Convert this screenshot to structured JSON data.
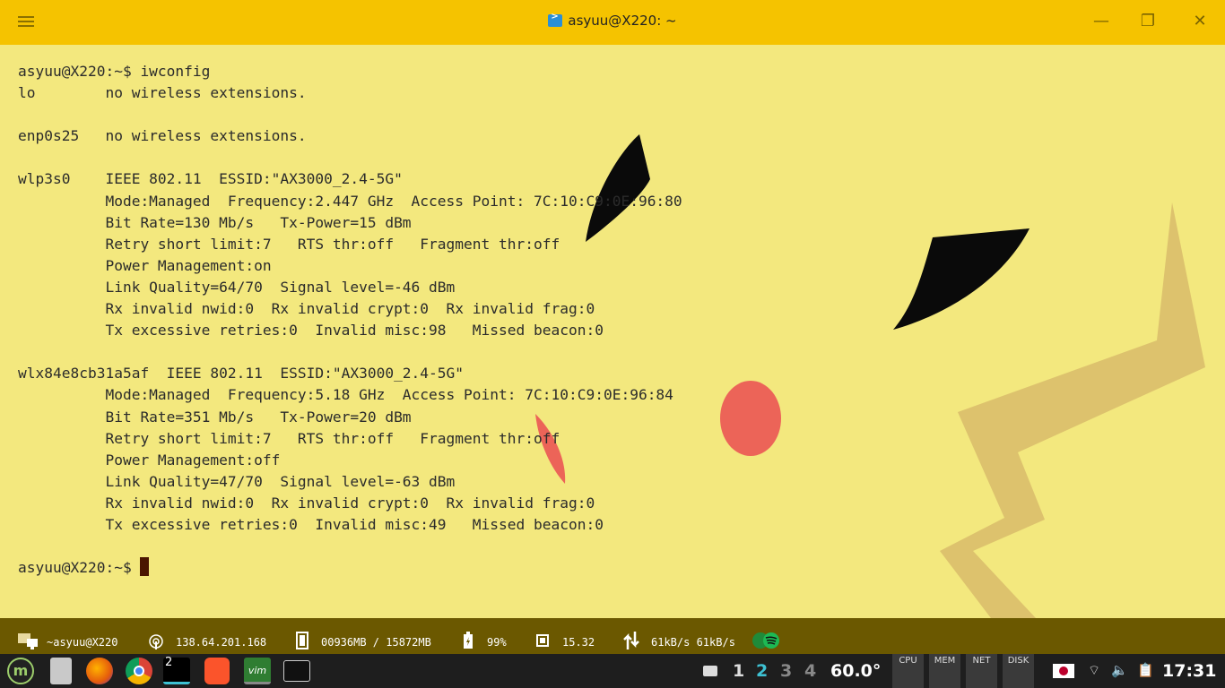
{
  "window": {
    "title": "asyuu@X220: ~",
    "menu_icon": "hamburger-icon",
    "minimize_icon": "minimize-icon",
    "maximize_icon": "restore-icon",
    "close_icon": "close-icon",
    "colors": {
      "titlebar": "#f5c300",
      "background": "#f3e87e"
    }
  },
  "terminal": {
    "lines": [
      "asyuu@X220:~$ iwconfig",
      "lo        no wireless extensions.",
      "",
      "enp0s25   no wireless extensions.",
      "",
      "wlp3s0    IEEE 802.11  ESSID:\"AX3000_2.4-5G\"",
      "          Mode:Managed  Frequency:2.447 GHz  Access Point: 7C:10:C9:0E:96:80",
      "          Bit Rate=130 Mb/s   Tx-Power=15 dBm",
      "          Retry short limit:7   RTS thr:off   Fragment thr:off",
      "          Power Management:on",
      "          Link Quality=64/70  Signal level=-46 dBm",
      "          Rx invalid nwid:0  Rx invalid crypt:0  Rx invalid frag:0",
      "          Tx excessive retries:0  Invalid misc:98   Missed beacon:0",
      "",
      "wlx84e8cb31a5af  IEEE 802.11  ESSID:\"AX3000_2.4-5G\"",
      "          Mode:Managed  Frequency:5.18 GHz  Access Point: 7C:10:C9:0E:96:84",
      "          Bit Rate=351 Mb/s   Tx-Power=20 dBm",
      "          Retry short limit:7   RTS thr:off   Fragment thr:off",
      "          Power Management:off",
      "          Link Quality=47/70  Signal level=-63 dBm",
      "          Rx invalid nwid:0  Rx invalid crypt:0  Rx invalid frag:0",
      "          Tx excessive retries:0  Invalid misc:49   Missed beacon:0",
      "",
      "asyuu@X220:~$ "
    ]
  },
  "statusbar": {
    "user": "~asyuu@X220",
    "ip": "138.64.201.168",
    "memory": "00936MB / 15872MB",
    "battery": "99%",
    "cpu_load": "15.32",
    "network": "61kB/s 61kB/s",
    "icons": [
      "folder-network-icon",
      "wifi-antenna-icon",
      "memory-icon",
      "battery-icon",
      "cpu-icon",
      "transfer-arrows-icon",
      "spotify-icon"
    ]
  },
  "taskbar": {
    "apps": [
      "mint-menu-icon",
      "file-manager-icon",
      "firefox-icon",
      "chrome-icon",
      "terminal-icon",
      "brave-icon",
      "vim-icon",
      "system-monitor-icon"
    ],
    "terminal_badge": "2",
    "workspaces": [
      "1",
      "2",
      "3",
      "4"
    ],
    "active_workspace": "2",
    "temperature": "60.0°",
    "monitors": [
      "CPU",
      "MEM",
      "NET",
      "DISK"
    ],
    "tray_icons": [
      "keyboard-icon",
      "japan-flag-icon",
      "wifi-icon",
      "volume-icon",
      "clipboard-icon"
    ],
    "clock": "17:31"
  }
}
